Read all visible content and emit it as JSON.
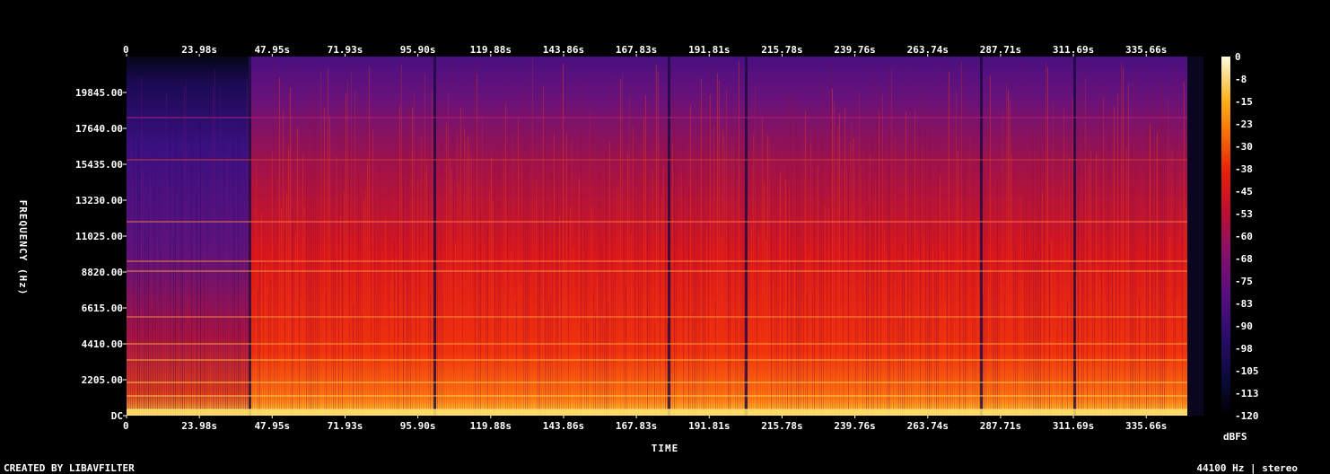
{
  "chart_data": {
    "type": "heatmap",
    "title": "",
    "xlabel": "TIME",
    "ylabel": "FREQUENCY (Hz)",
    "x_ticks": [
      "0",
      "23.98s",
      "47.95s",
      "71.93s",
      "95.90s",
      "119.88s",
      "143.86s",
      "167.83s",
      "191.81s",
      "215.78s",
      "239.76s",
      "263.74s",
      "287.71s",
      "311.69s",
      "335.66s"
    ],
    "x_tick_values": [
      0,
      23.98,
      47.95,
      71.93,
      95.9,
      119.88,
      143.86,
      167.83,
      191.81,
      215.78,
      239.76,
      263.74,
      287.71,
      311.69,
      335.66
    ],
    "xlim": [
      0,
      354.5
    ],
    "y_ticks": [
      "DC",
      "2205.00",
      "4410.00",
      "6615.00",
      "8820.00",
      "11025.00",
      "13230.00",
      "15435.00",
      "17640.00",
      "19845.00"
    ],
    "y_tick_values": [
      0,
      2205,
      4410,
      6615,
      8820,
      11025,
      13230,
      15435,
      17640,
      19845
    ],
    "ylim": [
      0,
      22050
    ],
    "colorbar": {
      "label": "dBFS",
      "ticks": [
        "0",
        "-8",
        "-15",
        "-23",
        "-30",
        "-38",
        "-45",
        "-53",
        "-60",
        "-68",
        "-75",
        "-83",
        "-90",
        "-98",
        "-105",
        "-113",
        "-120"
      ],
      "range": [
        -120,
        0
      ]
    },
    "colors": {
      "low": "#000000",
      "mid": "#cc1010",
      "high": "#ffff80"
    }
  },
  "footer": {
    "left": "CREATED BY LIBAVFILTER",
    "right": "44100 Hz | stereo"
  }
}
